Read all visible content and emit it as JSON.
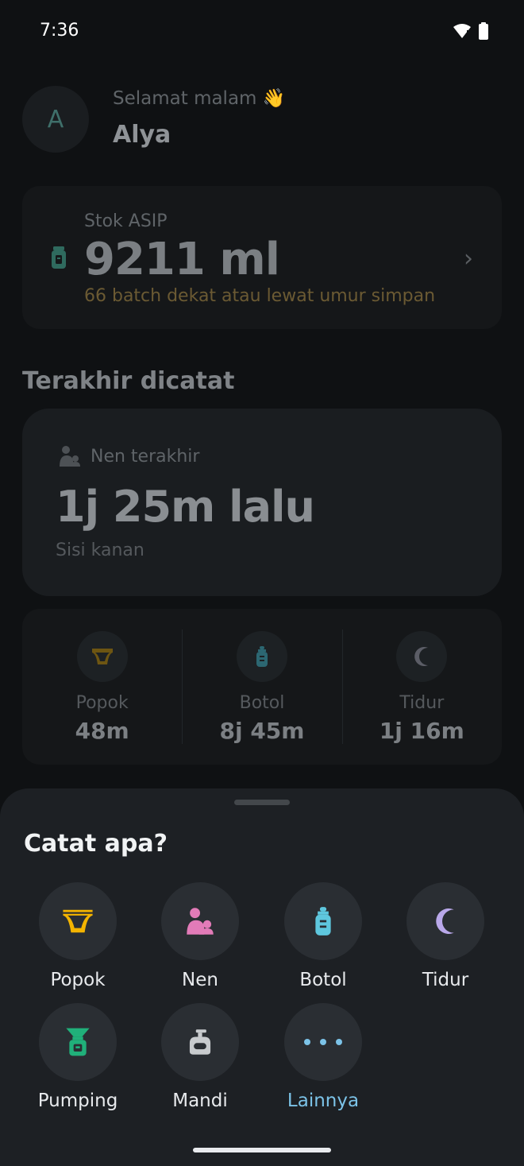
{
  "status": {
    "time": "7:36"
  },
  "greeting": {
    "avatar_letter": "A",
    "text": "Selamat malam 👋",
    "name": "Alya"
  },
  "stock": {
    "label": "Stok ASIP",
    "value": "9211 ml",
    "warning": "66 batch dekat atau lewat umur simpan",
    "icon": "milk-jar-icon",
    "warning_color": "#b8923a"
  },
  "recent": {
    "title": "Terakhir dicatat",
    "card": {
      "label": "Nen terakhir",
      "value": "1j 25m lalu",
      "sub": "Sisi kanan",
      "icon": "nursing-icon"
    },
    "stats": [
      {
        "label": "Popok",
        "value": "48m",
        "icon": "diaper-icon"
      },
      {
        "label": "Botol",
        "value": "8j 45m",
        "icon": "bottle-icon"
      },
      {
        "label": "Tidur",
        "value": "1j 16m",
        "icon": "moon-icon"
      }
    ]
  },
  "sheet": {
    "title": "Catat apa?",
    "actions": [
      {
        "label": "Popok",
        "icon": "diaper-icon",
        "color": "#f4b400"
      },
      {
        "label": "Nen",
        "icon": "nursing-icon",
        "color": "#e27bb8"
      },
      {
        "label": "Botol",
        "icon": "bottle-icon",
        "color": "#5ec7de"
      },
      {
        "label": "Tidur",
        "icon": "moon-icon",
        "color": "#b9a8ea"
      },
      {
        "label": "Pumping",
        "icon": "pump-icon",
        "color": "#20b07a"
      },
      {
        "label": "Mandi",
        "icon": "soap-icon",
        "color": "#c8cbce"
      },
      {
        "label": "Lainnya",
        "icon": "more-icon",
        "color": "#7cc3e8"
      }
    ]
  }
}
